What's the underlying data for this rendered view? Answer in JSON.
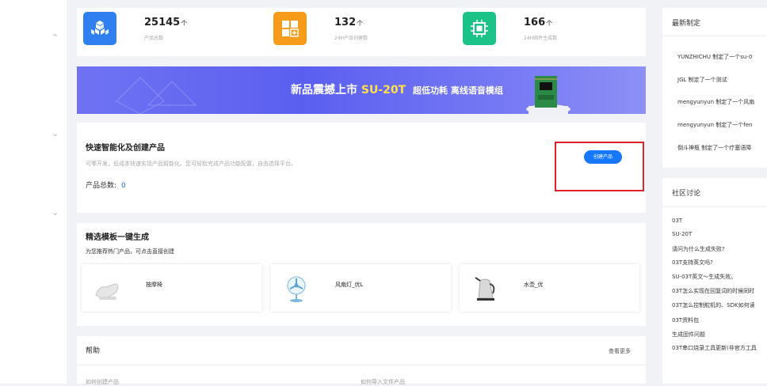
{
  "stats": [
    {
      "number": "25145",
      "unit": "个",
      "caption": "产品总数",
      "color": "#2f7ff0"
    },
    {
      "number": "132",
      "unit": "个",
      "caption": "24H产品创建数",
      "color": "#f79b1a"
    },
    {
      "number": "166",
      "unit": "个",
      "caption": "24H固件生成数",
      "color": "#1cc388"
    }
  ],
  "banner": {
    "title_a": "新品震撼上市",
    "title_b": "SU-20T",
    "title_c": "超低功耗  离线语音模组"
  },
  "quick_create": {
    "title": "快速智能化及创建产品",
    "description": "可零开发，低成本快速实现产品智能化。您可轻松完成产品功能配置，自由选择平台。",
    "count_label": "产品总数:",
    "count_value": "0",
    "button_label": "创建产品"
  },
  "templates": {
    "title": "精选模板一键生成",
    "subtitle": "为您推荐热门产品，可点击直接创建",
    "items": [
      {
        "name": "按摩椅"
      },
      {
        "name": "风扇灯_优L"
      },
      {
        "name": "水壶_优"
      }
    ]
  },
  "help": {
    "title": "帮助",
    "more": "查看更多",
    "items": [
      "如何创建产品",
      "如何导入文件产品"
    ]
  },
  "recent": {
    "title": "最新制定",
    "items": [
      "YUNZHICHU 制定了一个su-0",
      "JGL 制定了一个测试",
      "mengyunyun 制定了一个风扇",
      "mengyunyun 制定了一个fen",
      "倒斗神瓶 制定了一个疗塞语障"
    ]
  },
  "discussion": {
    "title": "社区讨论",
    "items": [
      "03T",
      "SU-20T",
      "请问为什么生成失败?",
      "03T支持英文吗?",
      "SU-03T英文～生成失败。",
      "03T怎么实现在回复词的时候同时",
      "03T怎么控制舵机的、SDK如何读",
      "03T资料包",
      "生成固件问题",
      "03T串口烧录工具更新(非官方工具"
    ]
  }
}
